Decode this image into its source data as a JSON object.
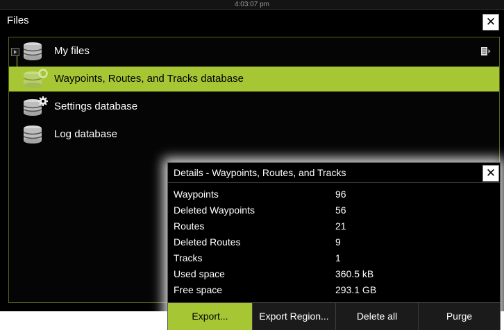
{
  "status_bar": {
    "time": "4:03:07 pm"
  },
  "window": {
    "title": "Files",
    "close_label": "✕"
  },
  "tree": {
    "items": [
      {
        "label": "My files"
      },
      {
        "label": "Waypoints, Routes, and Tracks database"
      },
      {
        "label": "Settings database"
      },
      {
        "label": "Log database"
      }
    ]
  },
  "details": {
    "title": "Details - Waypoints, Routes, and Tracks",
    "close_label": "✕",
    "stats": [
      {
        "label": "Waypoints",
        "value": "96"
      },
      {
        "label": "Deleted Waypoints",
        "value": "56"
      },
      {
        "label": "Routes",
        "value": "21"
      },
      {
        "label": "Deleted Routes",
        "value": "9"
      },
      {
        "label": "Tracks",
        "value": "1"
      },
      {
        "label": "Used space",
        "value": "360.5 kB"
      },
      {
        "label": "Free space",
        "value": "293.1 GB"
      }
    ],
    "buttons": {
      "export": "Export...",
      "export_region": "Export Region...",
      "delete_all": "Delete all",
      "purge": "Purge"
    }
  },
  "colors": {
    "accent": "#a6c634",
    "background": "#000000",
    "text": "#ffffff"
  },
  "icons": [
    "database-icon",
    "settings-database-icon",
    "waypoint-database-icon",
    "list-menu-icon",
    "close-icon",
    "expand-arrow-icon"
  ]
}
